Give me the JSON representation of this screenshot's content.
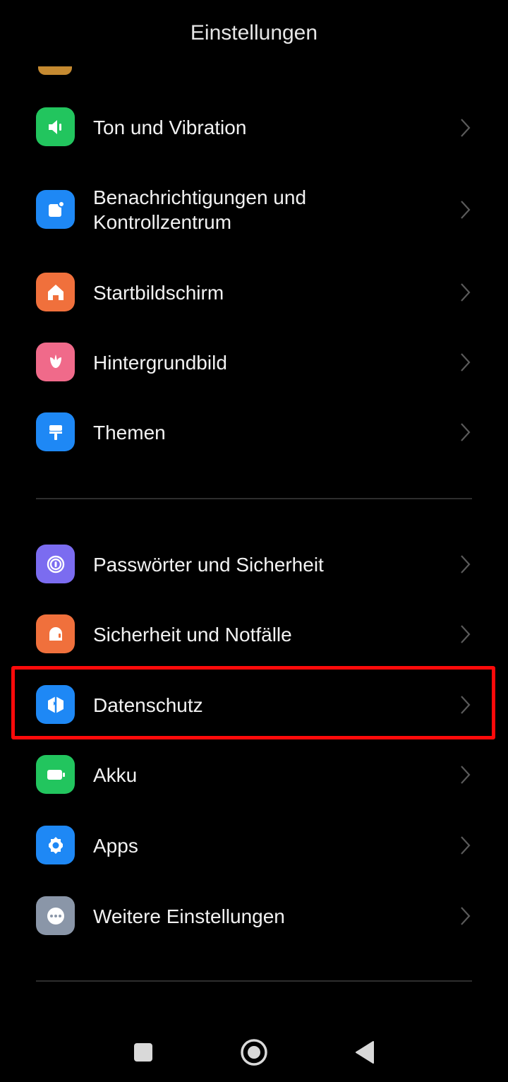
{
  "header": {
    "title": "Einstellungen"
  },
  "settings_group_1": [
    {
      "label": "Ton und Vibration",
      "icon": "speaker-icon",
      "color": "#22c55e"
    },
    {
      "label_line1": "Benachrichtigungen und",
      "label_line2": "Kontrollzentrum",
      "icon": "notification-icon",
      "color": "#1e88f5"
    },
    {
      "label": "Startbildschirm",
      "icon": "home-icon",
      "color": "#f0703c"
    },
    {
      "label": "Hintergrundbild",
      "icon": "tulip-icon",
      "color": "#f06a8a"
    },
    {
      "label": "Themen",
      "icon": "paint-brush-icon",
      "color": "#1e88f5"
    }
  ],
  "settings_group_2": [
    {
      "label": "Passwörter und Sicherheit",
      "icon": "fingerprint-icon",
      "color": "#7b6cf0"
    },
    {
      "label": "Sicherheit und Notfälle",
      "icon": "emergency-light-icon",
      "color": "#f0703c"
    },
    {
      "label": "Datenschutz",
      "icon": "privacy-shield-icon",
      "color": "#1e88f5",
      "highlighted": true
    },
    {
      "label": "Akku",
      "icon": "battery-icon",
      "color": "#22c55e"
    },
    {
      "label": "Apps",
      "icon": "gear-icon",
      "color": "#1e88f5"
    },
    {
      "label": "Weitere Einstellungen",
      "icon": "more-dots-icon",
      "color": "#8a96a8"
    }
  ],
  "navbar": {
    "buttons": [
      "recents-button",
      "home-button",
      "back-button"
    ]
  }
}
